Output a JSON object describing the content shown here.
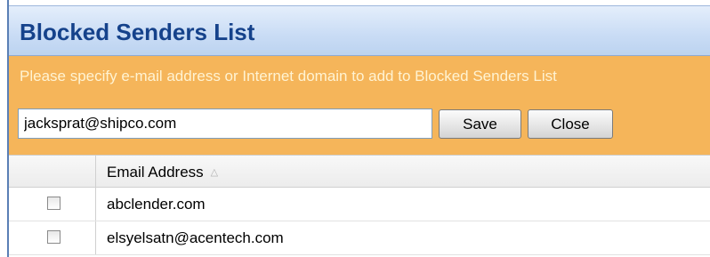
{
  "panel": {
    "title": "Blocked Senders List",
    "instruction": "Please specify e-mail address or Internet domain to add to Blocked Senders List"
  },
  "form": {
    "email_value": "jacksprat@shipco.com",
    "save_label": "Save",
    "close_label": "Close"
  },
  "grid": {
    "columns": {
      "email_header": "Email Address",
      "sort_indicator": "△"
    },
    "rows": [
      {
        "email": "abclender.com",
        "checked": false
      },
      {
        "email": "elsyelsatn@acentech.com",
        "checked": false
      }
    ]
  },
  "colors": {
    "title_text": "#15428b",
    "instruction_band": "#f5b55a",
    "frame_border": "#5a7fb5"
  }
}
